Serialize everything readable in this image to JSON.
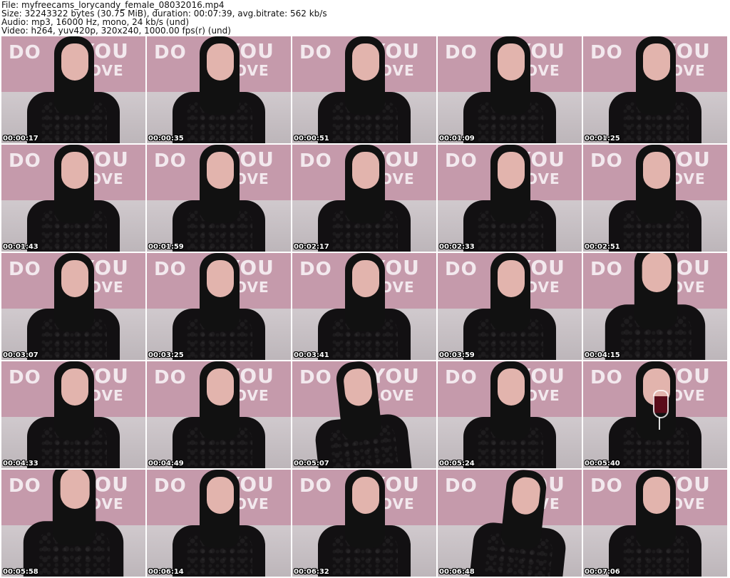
{
  "header": {
    "file_line": "File: myfreecams_lorycandy_female_08032016.mp4",
    "size_line": "Size: 32243322 bytes (30.75 MiB), duration: 00:07:39, avg.bitrate: 562 kb/s",
    "audio_line": "Audio: mp3, 16000 Hz, mono, 24 kb/s (und)",
    "video_line": "Video: h264, yuv420p, 320x240, 1000.00 fps(r) (und)"
  },
  "banner_text": {
    "w1": "DO",
    "w2": "YOU",
    "w3": "LOVE"
  },
  "thumbnails": [
    {
      "time": "00:00:17",
      "pose": "normal"
    },
    {
      "time": "00:00:35",
      "pose": "normal"
    },
    {
      "time": "00:00:51",
      "pose": "normal"
    },
    {
      "time": "00:01:09",
      "pose": "normal"
    },
    {
      "time": "00:01:25",
      "pose": "normal"
    },
    {
      "time": "00:01:43",
      "pose": "normal"
    },
    {
      "time": "00:01:59",
      "pose": "normal"
    },
    {
      "time": "00:02:17",
      "pose": "normal"
    },
    {
      "time": "00:02:33",
      "pose": "normal"
    },
    {
      "time": "00:02:51",
      "pose": "normal"
    },
    {
      "time": "00:03:07",
      "pose": "normal"
    },
    {
      "time": "00:03:25",
      "pose": "normal"
    },
    {
      "time": "00:03:41",
      "pose": "normal"
    },
    {
      "time": "00:03:59",
      "pose": "normal"
    },
    {
      "time": "00:04:15",
      "pose": "close"
    },
    {
      "time": "00:04:33",
      "pose": "normal"
    },
    {
      "time": "00:04:49",
      "pose": "normal"
    },
    {
      "time": "00:05:07",
      "pose": "tilt"
    },
    {
      "time": "00:05:24",
      "pose": "normal"
    },
    {
      "time": "00:05:40",
      "pose": "drink"
    },
    {
      "time": "00:05:58",
      "pose": "close"
    },
    {
      "time": "00:06:14",
      "pose": "normal"
    },
    {
      "time": "00:06:32",
      "pose": "normal"
    },
    {
      "time": "00:06:48",
      "pose": "lean"
    },
    {
      "time": "00:07:06",
      "pose": "normal"
    }
  ]
}
